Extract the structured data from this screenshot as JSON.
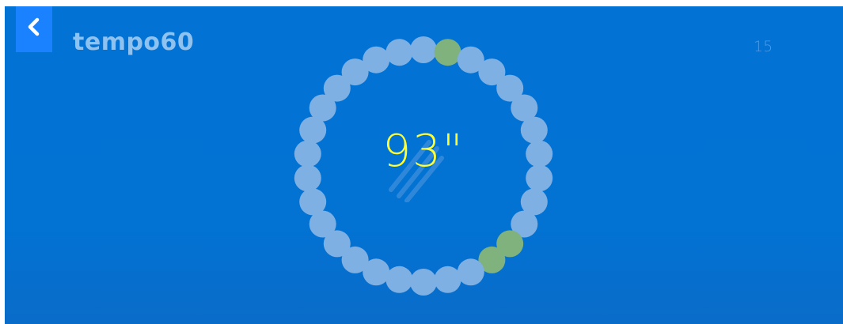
{
  "header": {
    "title": "tempo60",
    "counter": "15"
  },
  "timer": {
    "display": "93\""
  },
  "ring": {
    "dot_count": 30,
    "active_dot_indices": [
      1,
      11,
      12
    ],
    "colors": {
      "inactive": "#7fb0e3",
      "active": "#7fb27d",
      "timer_text": "#ffff33",
      "background": "#0273d4",
      "back_button": "#1a82ff"
    }
  },
  "icons": {
    "back": "chevron-left-icon",
    "center": "stripes-logo-icon"
  }
}
